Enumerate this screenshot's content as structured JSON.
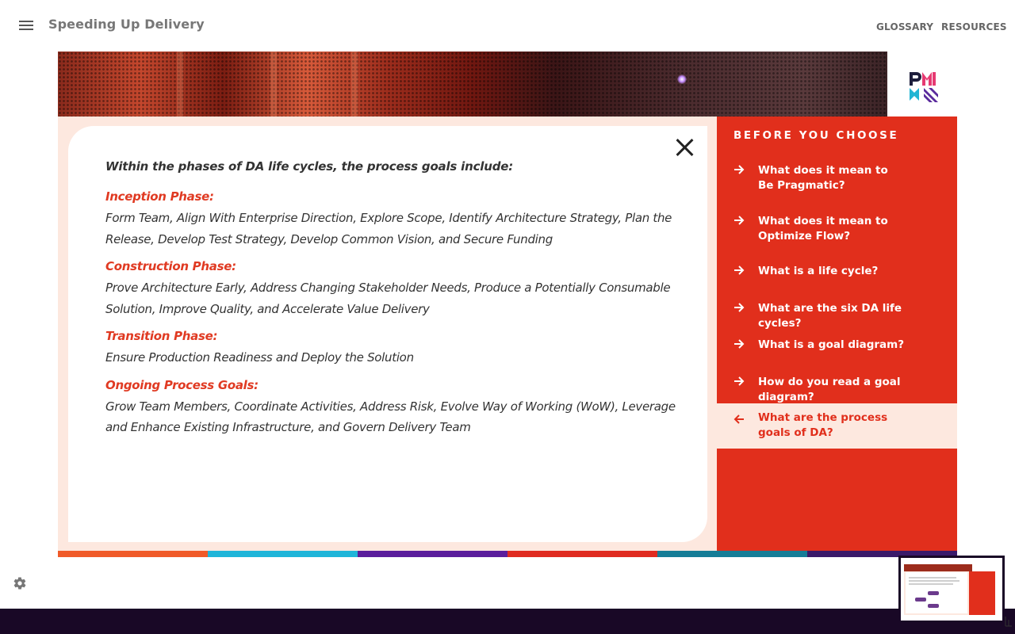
{
  "header": {
    "course_title": "Speeding Up Delivery",
    "links": {
      "glossary": "GLOSSARY",
      "resources": "RESOURCES"
    }
  },
  "content": {
    "intro": "Within the phases of DA life cycles, the process goals include:",
    "phases": [
      {
        "title": "Inception Phase:",
        "text": "Form Team, Align With Enterprise Direction, Explore Scope, Identify Architecture Strategy, Plan the Release, Develop Test Strategy, Develop Common Vision, and Secure Funding"
      },
      {
        "title": "Construction Phase:",
        "text": "Prove Architecture Early, Address Changing Stakeholder Needs, Produce a Potentially Consumable Solution, Improve Quality, and Accelerate Value Delivery"
      },
      {
        "title": "Transition Phase:",
        "text": "Ensure Production Readiness and Deploy the Solution"
      },
      {
        "title": "Ongoing Process Goals:",
        "text": "Grow Team Members, Coordinate Activities, Address Risk, Evolve Way of Working (WoW), Leverage and Enhance Existing Infrastructure, and Govern Delivery Team"
      }
    ]
  },
  "sidebar": {
    "title": "BEFORE YOU CHOOSE",
    "items": [
      {
        "line1": "What does it mean to",
        "line2": "Be Pragmatic?"
      },
      {
        "line1": "What does it mean to",
        "line2": "Optimize Flow?"
      },
      {
        "line1": "What is a life cycle?",
        "line2": ""
      },
      {
        "line1": "What are the six DA life cycles?",
        "line2": ""
      },
      {
        "line1": "What is a goal diagram?",
        "line2": ""
      },
      {
        "line1": "How do you read a goal diagram?",
        "line2": ""
      },
      {
        "line1": "What are the process",
        "line2": "goals of DA?",
        "active": true
      }
    ]
  },
  "colors": {
    "accent_red": "#e12f1c",
    "panel_peach": "#fde8df",
    "footer_dark": "#190826",
    "bottom_stripes": [
      "#f05a28",
      "#1fb5d9",
      "#5b1e9c",
      "#e02b20",
      "#157d97",
      "#3a1a6a"
    ]
  },
  "icons": {
    "menu": "hamburger-icon",
    "close": "close-icon",
    "arrow": "arrow-right-icon",
    "back": "arrow-left-icon",
    "settings": "gear-icon",
    "logo": "pmi-logo"
  }
}
